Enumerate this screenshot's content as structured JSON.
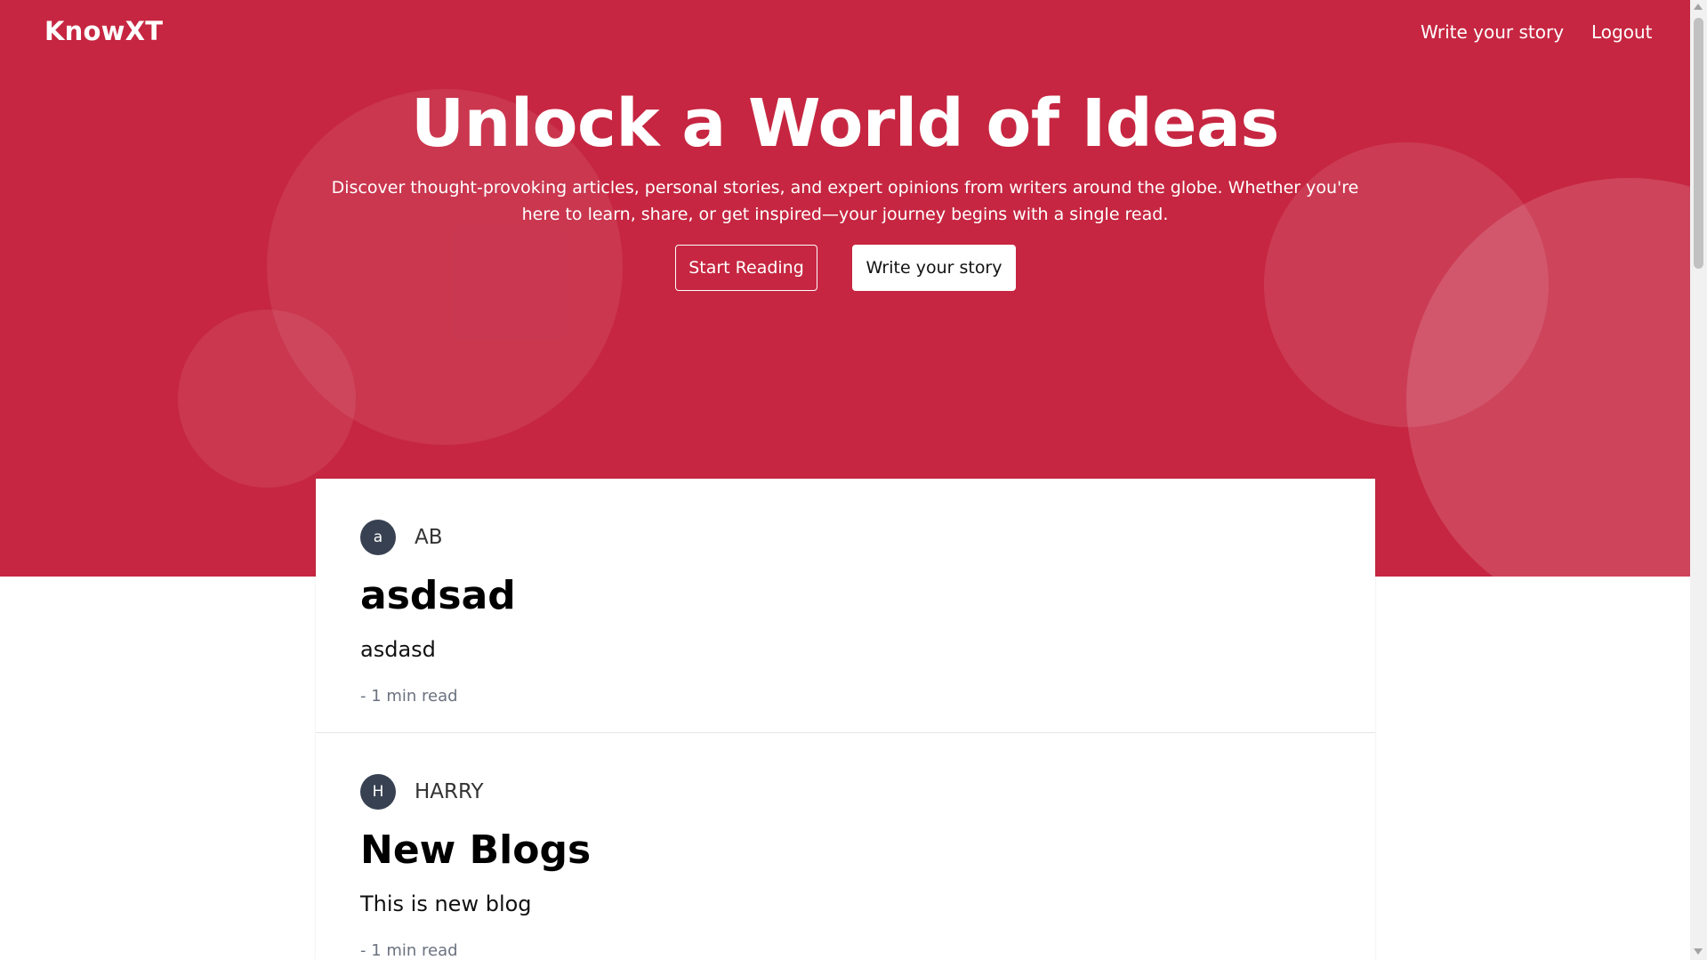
{
  "colors": {
    "hero_background": "#c62641",
    "avatar_background": "#374151"
  },
  "navbar": {
    "brand": "KnowXT",
    "links": [
      {
        "label": "Write your story"
      },
      {
        "label": "Logout"
      }
    ]
  },
  "hero": {
    "title": "Unlock a World of Ideas",
    "subtitle": "Discover thought-provoking articles, personal stories, and expert opinions from writers around the globe. Whether you're here to learn, share, or get inspired—your journey begins with a single read.",
    "primary_button": "Start Reading",
    "secondary_button": "Write your story"
  },
  "posts": [
    {
      "avatar_initial": "a",
      "author": "AB",
      "title": "asdsad",
      "excerpt": "asdasd",
      "meta": "- 1 min read"
    },
    {
      "avatar_initial": "H",
      "author": "HARRY",
      "title": "New Blogs",
      "excerpt": "This is new blog",
      "meta": "- 1 min read"
    }
  ]
}
